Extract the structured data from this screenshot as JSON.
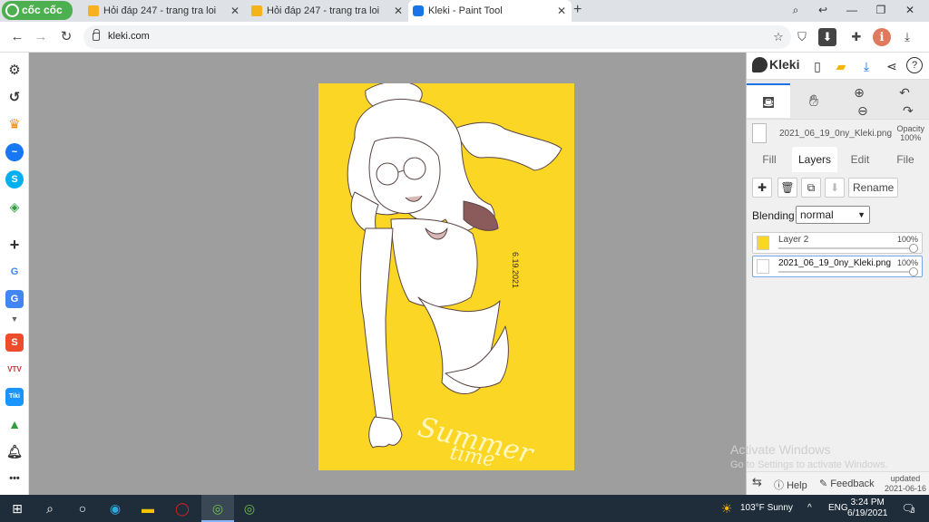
{
  "browser": {
    "logo_text": "cốc cốc",
    "tabs": [
      {
        "title": "Hỏi đáp 247 - trang tra loi",
        "active": false
      },
      {
        "title": "Hỏi đáp 247 - trang tra loi",
        "active": false
      },
      {
        "title": "Kleki - Paint Tool",
        "active": true
      }
    ],
    "url": "kleki.com"
  },
  "kleki": {
    "logo": "Kleki",
    "file_name": "2021_06_19_0ny_Kleki.png",
    "opacity_label": "Opacity",
    "opacity_value": "100%",
    "tabs": [
      "Fill",
      "Layers",
      "Edit",
      "File"
    ],
    "active_tab": "Layers",
    "rename_label": "Rename",
    "blending_label": "Blending",
    "blending_value": "normal",
    "layers": [
      {
        "name": "Layer 2",
        "opacity": "100%"
      },
      {
        "name": "2021_06_19_0ny_Kleki.png",
        "opacity": "100%",
        "selected": true
      }
    ],
    "help_label": "Help",
    "feedback_label": "Feedback",
    "updated_label": "updated",
    "updated_date": "2021-06-16"
  },
  "artwork": {
    "signature_date": "6.19.2021",
    "caption_line1": "Summer",
    "caption_line2": "time",
    "background_color": "#fcd624"
  },
  "os": {
    "watermark_title": "Activate Windows",
    "watermark_sub": "Go to Settings to activate Windows.",
    "weather": "103°F  Sunny",
    "lang": "ENG",
    "time": "3:24 PM",
    "date": "6/19/2021",
    "notif_count": "3"
  }
}
